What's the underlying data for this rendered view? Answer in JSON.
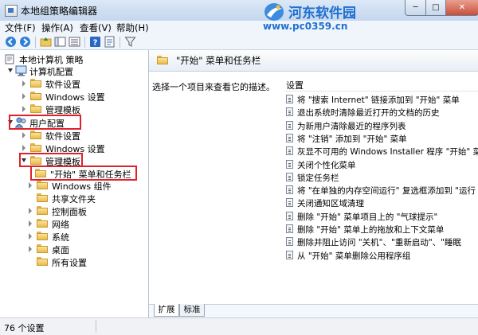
{
  "window": {
    "title": "本地组策略编辑器",
    "watermark_main": "河东软件园",
    "watermark_url": "www.pc0359.cn",
    "minimize_glyph": "─",
    "maximize_glyph": "□",
    "close_glyph": "✕"
  },
  "menu": [
    "文件(F)",
    "操作(A)",
    "查看(V)",
    "帮助(H)"
  ],
  "toolbar_icons": [
    "back-icon",
    "forward-icon",
    "up-folder-icon",
    "show-hide-tree-icon",
    "list-view-icon",
    "help-icon",
    "properties-icon",
    "filter-icon"
  ],
  "tree": {
    "root": "本地计算机 策略",
    "computer_config": "计算机配置",
    "cc_software": "软件设置",
    "cc_windows": "Windows 设置",
    "cc_admin": "管理模板",
    "user_config": "用户配置",
    "uc_software": "软件设置",
    "uc_windows": "Windows 设置",
    "uc_admin": "管理模板",
    "start_menu": "\"开始\" 菜单和任务栏",
    "windows_components": "Windows 组件",
    "shared_folders": "共享文件夹",
    "control_panel": "控制面板",
    "network": "网络",
    "system": "系统",
    "desktop": "桌面",
    "all_settings": "所有设置"
  },
  "right": {
    "header_title": "\"开始\" 菜单和任务栏",
    "description": "选择一个项目来查看它的描述。",
    "column_header": "设置",
    "items": [
      "将 \"搜索 Internet\" 链接添加到 \"开始\" 菜单",
      "退出系统时清除最近打开的文档的历史",
      "为新用户清除最近的程序列表",
      "将 \"注销\" 添加到 \"开始\" 菜单",
      "灰显不可用的 Windows Installer 程序 \"开始\" 菜",
      "关闭个性化菜单",
      "锁定任务栏",
      "将 \"在单独的内存空间运行\" 复选框添加到 \"运行",
      "关闭通知区域清理",
      "删除 \"开始\" 菜单项目上的 \"气球提示\"",
      "删除 \"开始\" 菜单上的拖放和上下文菜单",
      "删除并阻止访问 \"关机\"、\"重新启动\"、\"睡眠",
      "从 \"开始\" 菜单删除公用程序组"
    ],
    "tabs": [
      "扩展",
      "标准"
    ]
  },
  "status": {
    "count_text": "76 个设置"
  },
  "colors": {
    "highlight_box": "#e0202a",
    "watermark": "#1e6fd0"
  }
}
